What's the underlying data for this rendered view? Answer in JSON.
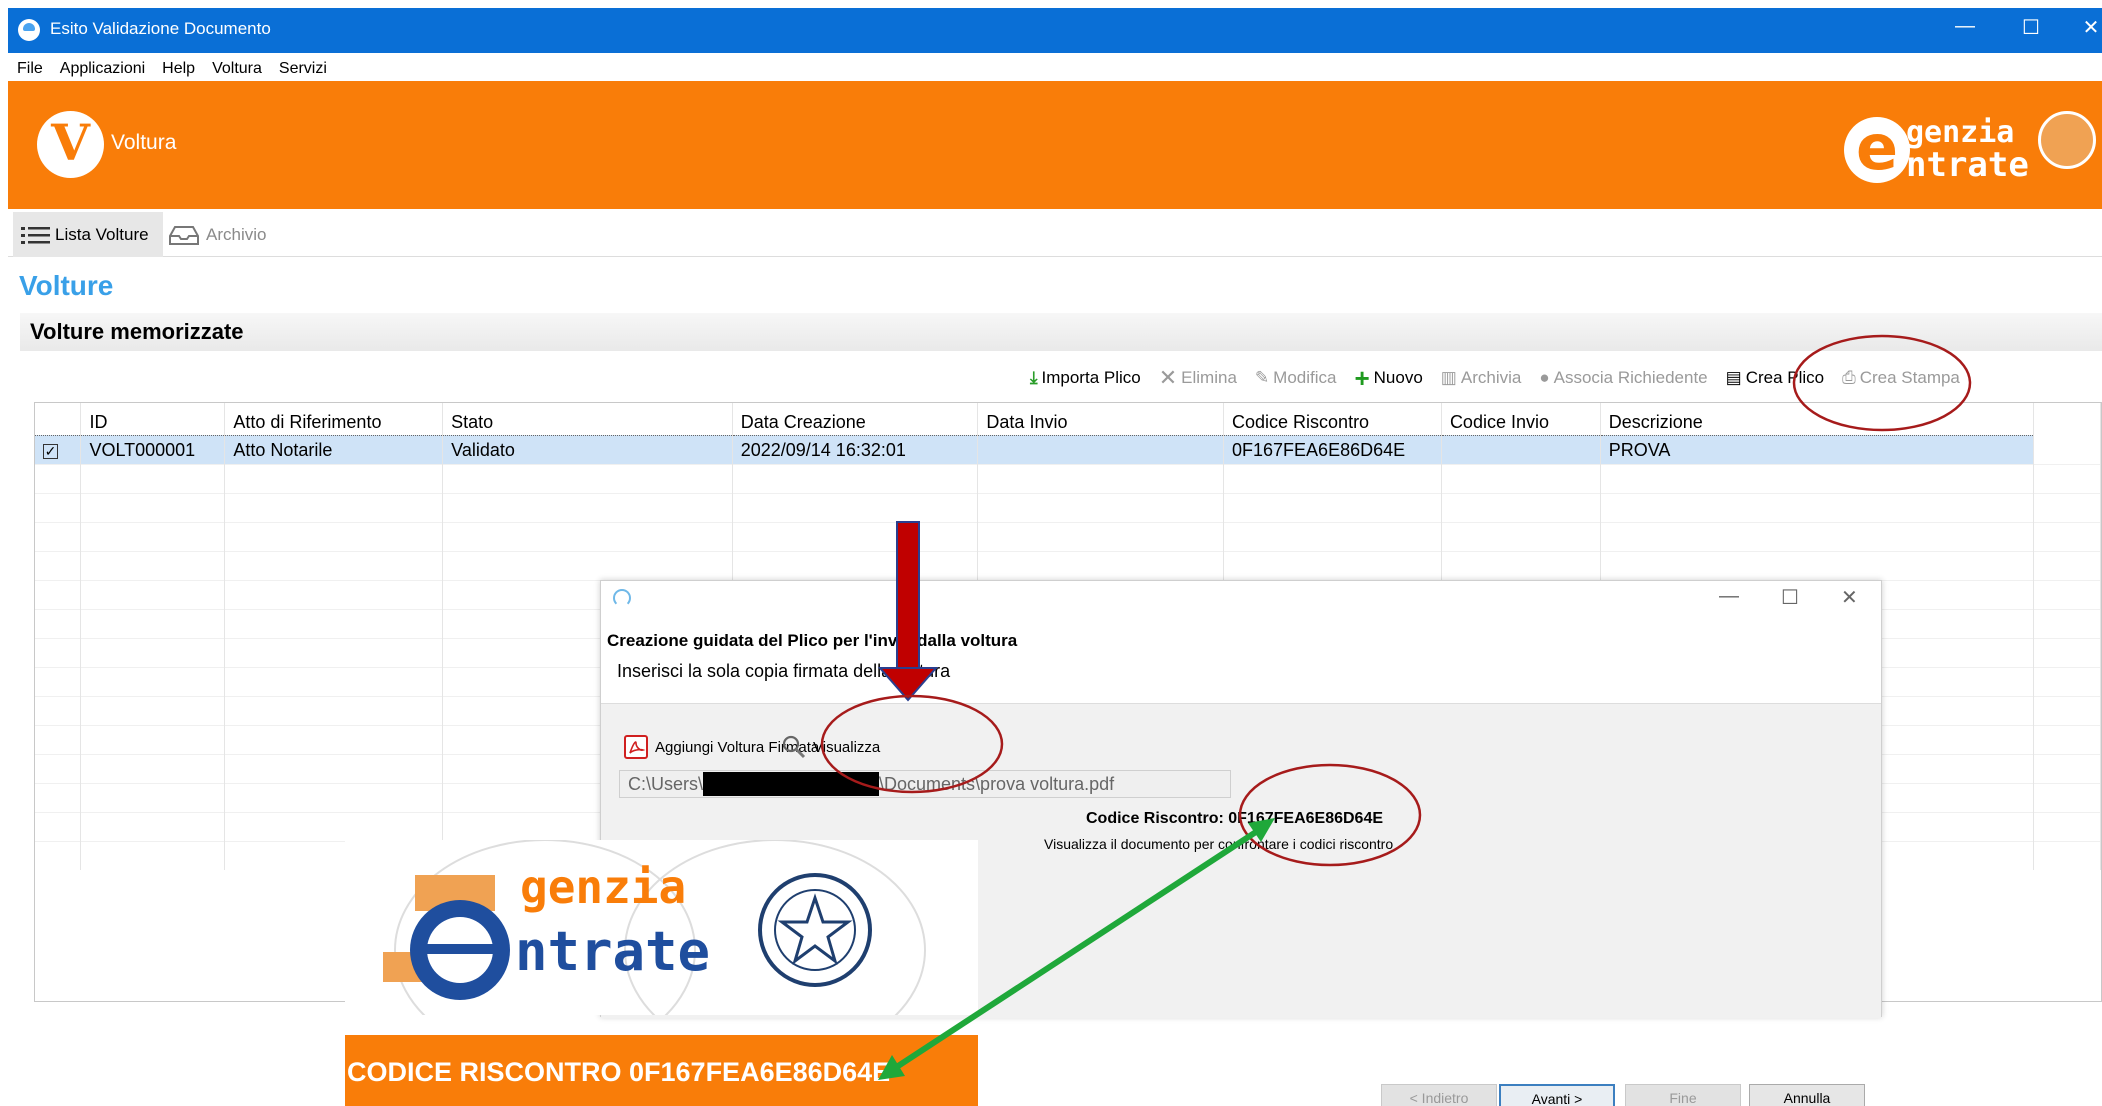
{
  "window": {
    "title": "Esito Validazione Documento",
    "minimize": "—",
    "maximize": "☐",
    "close": "✕"
  },
  "menu": [
    "File",
    "Applicazioni",
    "Help",
    "Voltura",
    "Servizi"
  ],
  "banner": {
    "app_name": "Voltura",
    "app_letter": "V",
    "brand_e": "e",
    "brand_line1": "genzia",
    "brand_line2": "ntrate",
    "colors": {
      "orange": "#f97d09"
    }
  },
  "tabs": [
    {
      "label": "Lista Volture",
      "active": true
    },
    {
      "label": "Archivio",
      "active": false
    }
  ],
  "section_title": "Volture",
  "subsection_title": "Volture memorizzate",
  "toolbar": [
    {
      "label": "Importa Plico",
      "icon": "import-icon",
      "enabled": true
    },
    {
      "label": "Elimina",
      "icon": "delete-icon",
      "enabled": false
    },
    {
      "label": "Modifica",
      "icon": "edit-icon",
      "enabled": false
    },
    {
      "label": "Nuovo",
      "icon": "plus-icon",
      "enabled": true
    },
    {
      "label": "Archivia",
      "icon": "archive-icon",
      "enabled": false
    },
    {
      "label": "Associa Richiedente",
      "icon": "person-icon",
      "enabled": false
    },
    {
      "label": "Crea Plico",
      "icon": "package-icon",
      "enabled": true
    },
    {
      "label": "Crea Stampa",
      "icon": "print-icon",
      "enabled": false
    }
  ],
  "table": {
    "columns": [
      "",
      "ID",
      "Atto di Riferimento",
      "Stato",
      "Data Creazione",
      "Data Invio",
      "Codice Riscontro",
      "Codice Invio",
      "Descrizione"
    ],
    "rows": [
      {
        "checked": true,
        "id": "VOLT000001",
        "atto": "Atto Notarile",
        "stato": "Validato",
        "data_creazione": "2022/09/14 16:32:01",
        "data_invio": "",
        "codice_riscontro": "0F167FEA6E86D64E",
        "codice_invio": "",
        "descrizione": "PROVA"
      }
    ],
    "empty_rows": 14
  },
  "dialog": {
    "heading": "Creazione guidata del Plico per l'invio dalla voltura",
    "instruction": "Inserisci la sola copia firmata della voltura",
    "add_button": "Aggiungi Voltura Firmata",
    "view_button": "Visualizza",
    "file_path_start": "C:\\Users\\",
    "file_path_end": "\\Documents\\prova voltura.pdf",
    "codice_label": "Codice Riscontro:",
    "codice_value": "0F167FEA6E86D64E",
    "note": "Visualizza il documento per confrontare i codici riscontro",
    "buttons": {
      "back": "< Indietro",
      "next": "Avanti >",
      "finish": "Fine",
      "cancel": "Annulla"
    }
  },
  "overlay": {
    "logo_line1": "genzia",
    "logo_line2": "ntrate",
    "logo_e": "e",
    "code_caption": "CODICE RISCONTRO 0F167FEA6E86D64E"
  }
}
